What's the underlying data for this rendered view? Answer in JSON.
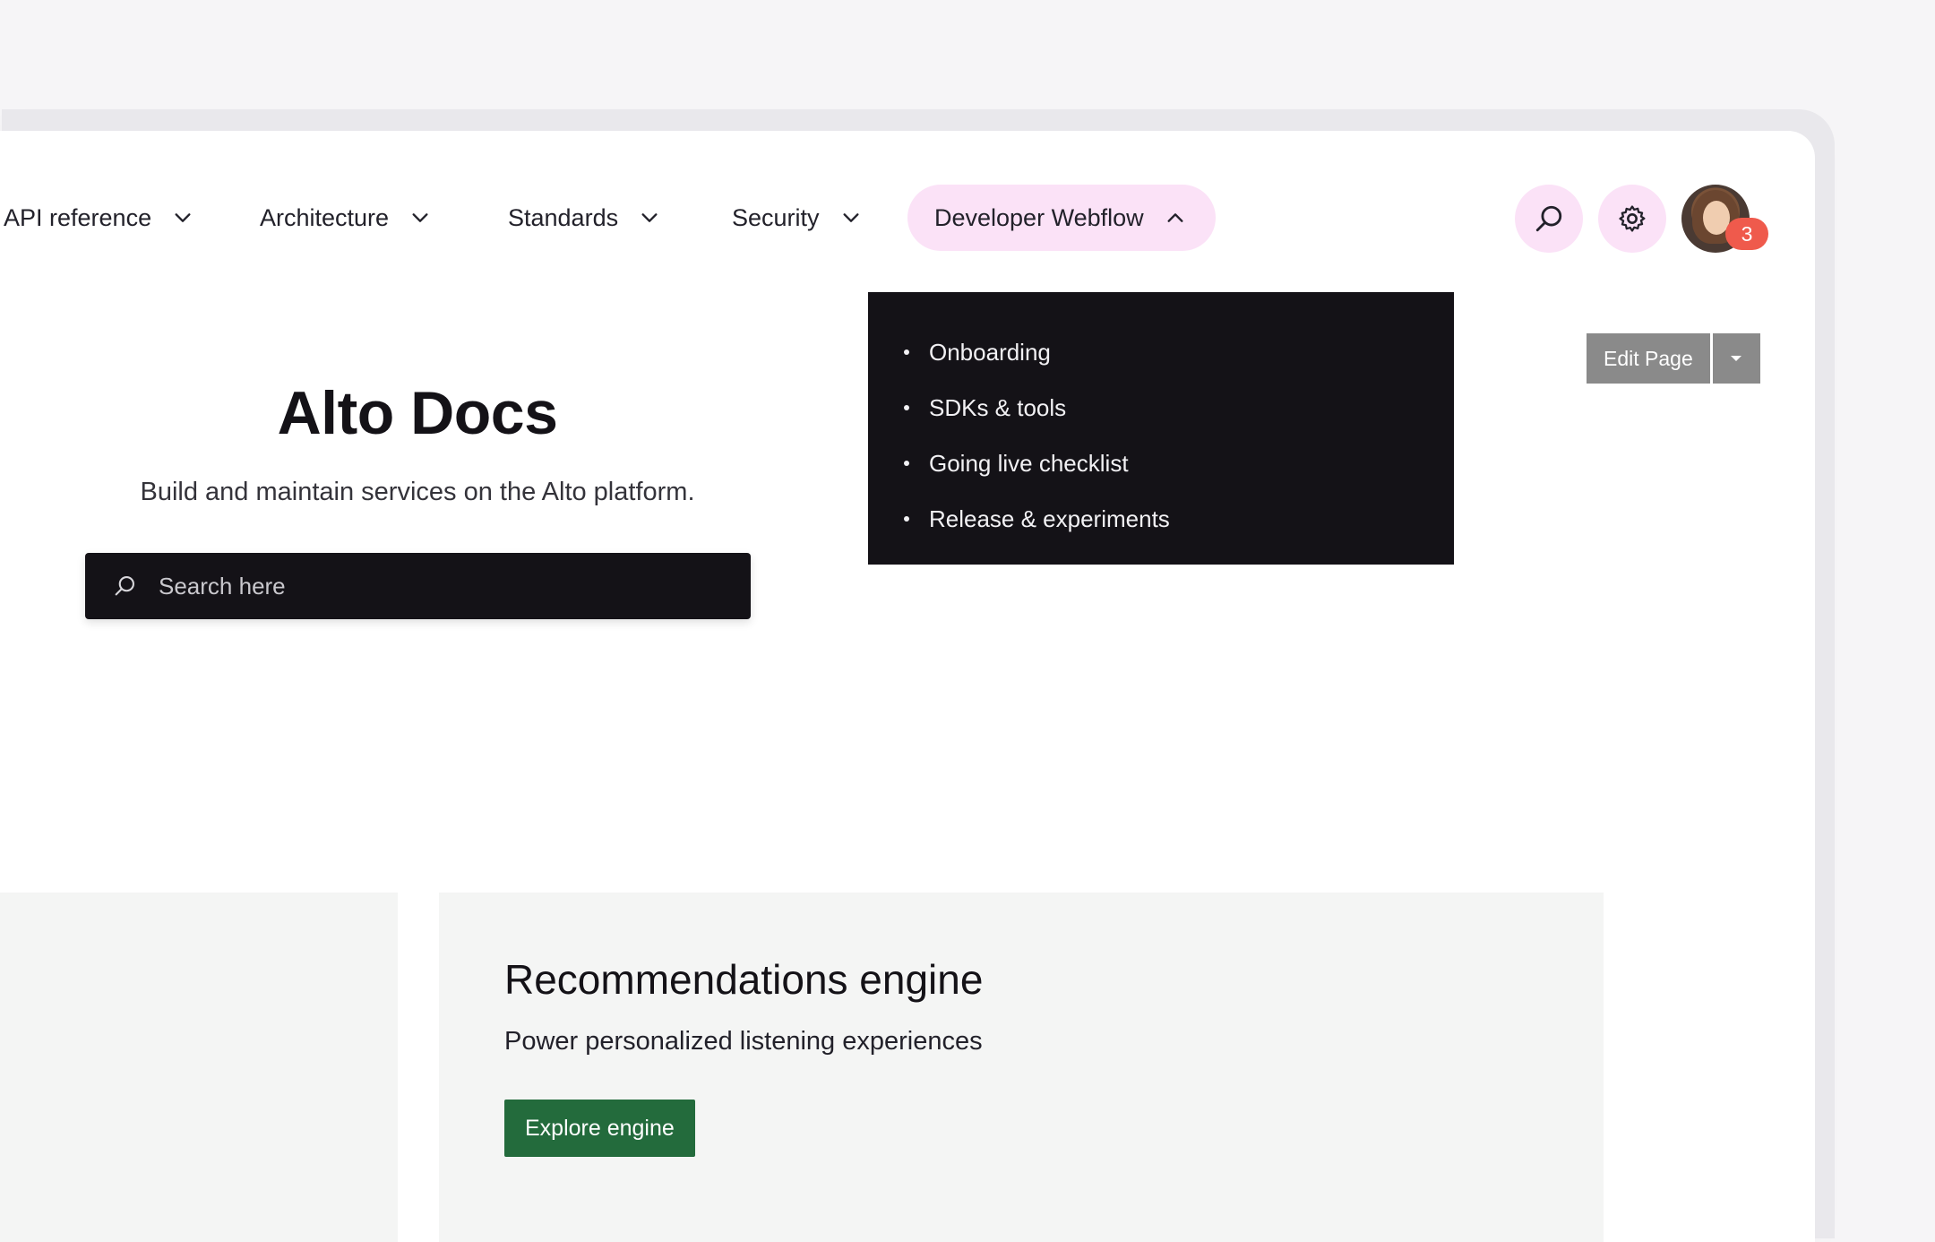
{
  "nav": {
    "items": [
      {
        "label": "API reference"
      },
      {
        "label": "Architecture"
      },
      {
        "label": "Standards"
      },
      {
        "label": "Security"
      },
      {
        "label": "Developer Webflow"
      }
    ],
    "active_index": 4,
    "notification_count": "3"
  },
  "dropdown": {
    "items": [
      "Onboarding",
      "SDKs & tools",
      "Going live checklist",
      "Release & experiments"
    ]
  },
  "edit": {
    "label": "Edit Page"
  },
  "hero": {
    "title": "Alto Docs",
    "subtitle": "Build and maintain services on the Alto platform.",
    "search_placeholder": "Search here"
  },
  "card": {
    "title": "Recommendations engine",
    "subtitle": "Power personalized listening experiences",
    "cta_label": "Explore engine"
  },
  "colors": {
    "accent_pill": "#fbe2f7",
    "dark": "#141217",
    "cta_green": "#236b3c",
    "badge_red": "#ef5a4c"
  }
}
